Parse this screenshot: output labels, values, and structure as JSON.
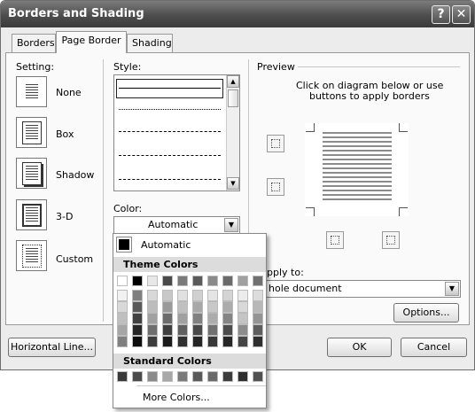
{
  "dialog": {
    "title": "Borders and Shading",
    "help_glyph": "?",
    "close_glyph": "✕"
  },
  "tabs": [
    {
      "label": "Borders"
    },
    {
      "label": "Page Border"
    },
    {
      "label": "Shading"
    }
  ],
  "setting": {
    "label": "Setting:",
    "items": [
      {
        "label": "None"
      },
      {
        "label": "Box"
      },
      {
        "label": "Shadow"
      },
      {
        "label": "3-D"
      },
      {
        "label": "Custom"
      }
    ]
  },
  "style": {
    "label": "Style:",
    "scroll_up": "▲",
    "scroll_down": "▼"
  },
  "color": {
    "label": "Color:",
    "value": "Automatic",
    "arrow": "▼"
  },
  "preview": {
    "label": "Preview",
    "instruction_line1": "Click on diagram below or use",
    "instruction_line2": "buttons to apply borders"
  },
  "apply_to": {
    "label": "pply to:",
    "value": "hole document",
    "arrow": "▼"
  },
  "buttons": {
    "options": "Options...",
    "horizontal_line": "Horizontal Line...",
    "ok": "OK",
    "cancel": "Cancel"
  },
  "color_menu": {
    "automatic": "Automatic",
    "theme_header": "Theme Colors",
    "standard_header": "Standard Colors",
    "more": "More Colors...",
    "theme_top_row": [
      "#ffffff",
      "#000000",
      "#e8e8e8",
      "#4a4a4a",
      "#7a7a7a",
      "#5a5a5a",
      "#8a8a8a",
      "#6a6a6a",
      "#a0a0a0",
      "#707070"
    ],
    "theme_columns": [
      [
        "#f2f2f2",
        "#d9d9d9",
        "#bfbfbf",
        "#a6a6a6",
        "#808080"
      ],
      [
        "#7f7f7f",
        "#595959",
        "#404040",
        "#262626",
        "#0d0d0d"
      ],
      [
        "#d8d8d8",
        "#bcbcbc",
        "#a0a0a0",
        "#6e6e6e",
        "#3c3c3c"
      ],
      [
        "#c8c8c8",
        "#9a9a9a",
        "#6c6c6c",
        "#3e3e3e",
        "#1a1a1a"
      ],
      [
        "#e0e0e0",
        "#c0c0c0",
        "#a0a0a0",
        "#606060",
        "#303030"
      ],
      [
        "#d0d0d0",
        "#a8a8a8",
        "#808080",
        "#484848",
        "#242424"
      ],
      [
        "#e4e4e4",
        "#c8c8c8",
        "#acacac",
        "#707070",
        "#383838"
      ],
      [
        "#d4d4d4",
        "#acacac",
        "#848484",
        "#4c4c4c",
        "#262626"
      ],
      [
        "#ececec",
        "#d8d8d8",
        "#c4c4c4",
        "#8c8c8c",
        "#464646"
      ],
      [
        "#dcdcdc",
        "#b8b8b8",
        "#949494",
        "#5e5e5e",
        "#2f2f2f"
      ]
    ],
    "standard": [
      "#3a3a3a",
      "#4a4a4a",
      "#8a8a8a",
      "#a8a8a8",
      "#7a7a7a",
      "#5a5a5a",
      "#6a6a6a",
      "#3c3c3c",
      "#2e2e2e",
      "#505050"
    ]
  }
}
